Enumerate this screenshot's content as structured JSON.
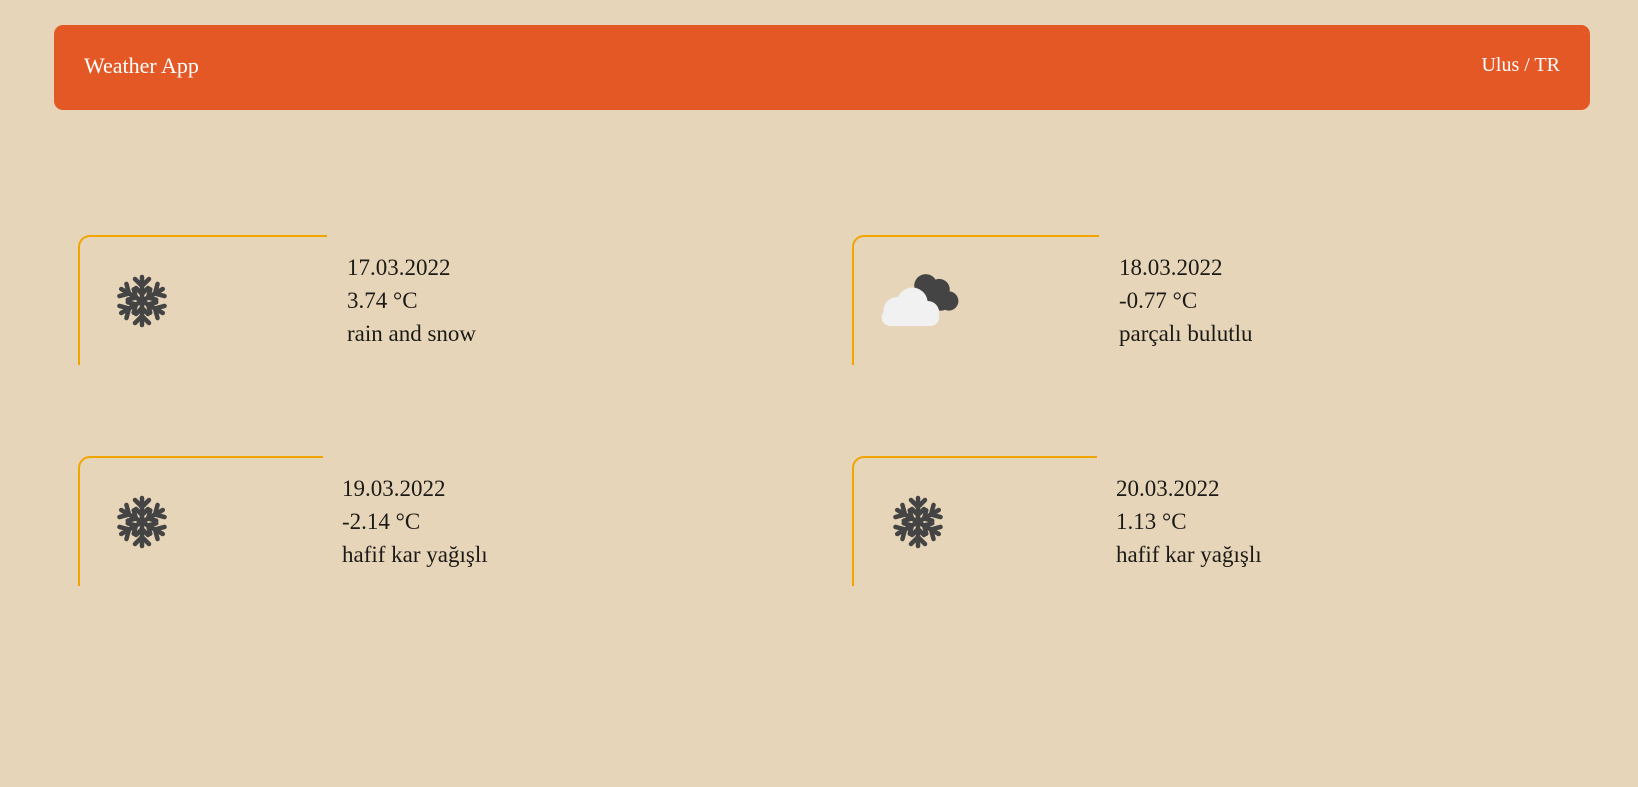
{
  "header": {
    "app_title": "Weather App",
    "location": "Ulus / TR"
  },
  "colors": {
    "background": "#e6d5b8",
    "header": "#e45826",
    "card_border": "#f0a500",
    "text": "#1b1a17"
  },
  "forecast": [
    {
      "date": "17.03.2022",
      "temperature": "3.74 °C",
      "description": "rain and snow",
      "icon": "snowflake-icon"
    },
    {
      "date": "18.03.2022",
      "temperature": "-0.77 °C",
      "description": "parçalı bulutlu",
      "icon": "clouds-icon"
    },
    {
      "date": "19.03.2022",
      "temperature": "-2.14 °C",
      "description": "hafif kar yağışlı",
      "icon": "snowflake-icon"
    },
    {
      "date": "20.03.2022",
      "temperature": "1.13 °C",
      "description": "hafif kar yağışlı",
      "icon": "snowflake-icon"
    }
  ]
}
